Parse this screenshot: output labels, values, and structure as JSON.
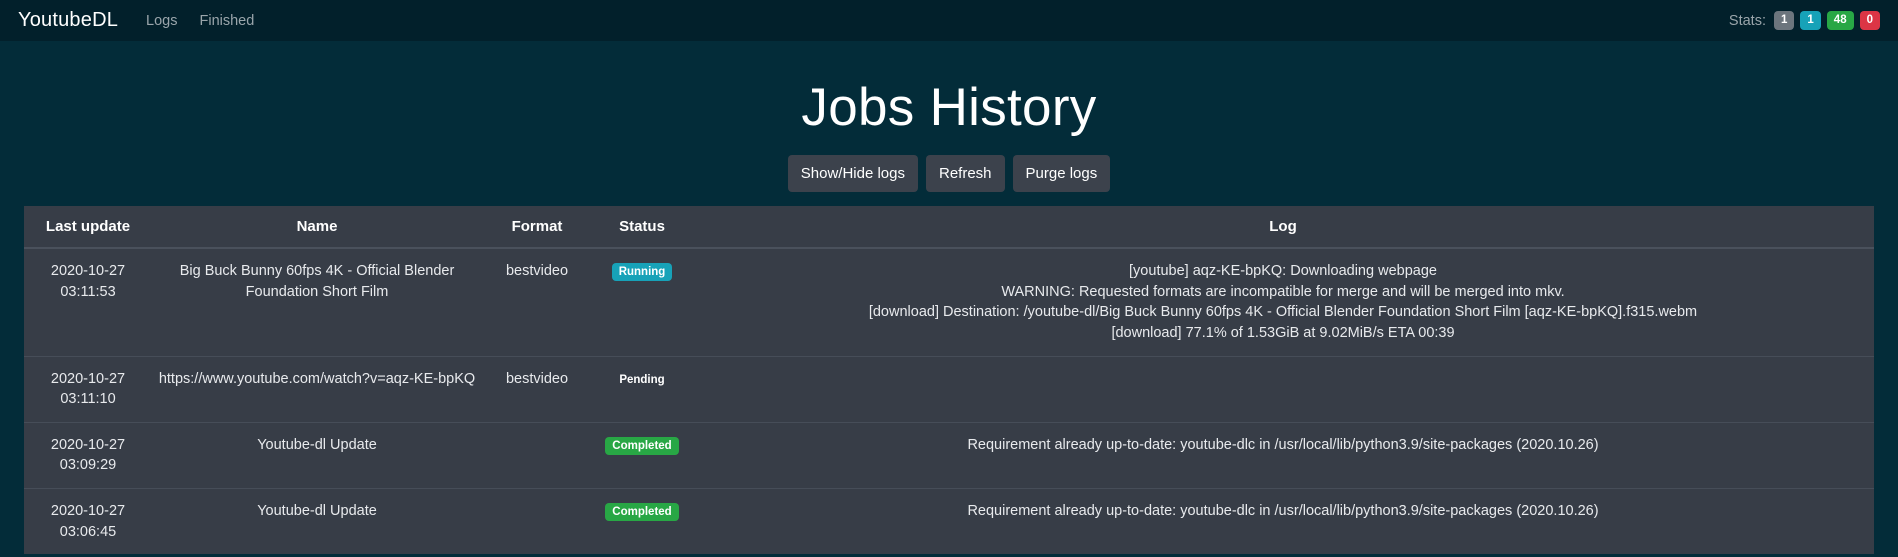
{
  "navbar": {
    "brand": "YoutubeDL",
    "links": [
      {
        "label": "Logs"
      },
      {
        "label": "Finished"
      }
    ],
    "stats_label": "Stats:",
    "stats": [
      {
        "value": "1",
        "variant": "secondary",
        "color": "#6c757d"
      },
      {
        "value": "1",
        "variant": "info",
        "color": "#17a2b8"
      },
      {
        "value": "48",
        "variant": "success",
        "color": "#28a745"
      },
      {
        "value": "0",
        "variant": "danger",
        "color": "#dc3545"
      }
    ]
  },
  "page": {
    "title": "Jobs History",
    "background_color": "#032c39",
    "navbar_color": "#02202b",
    "table_color": "#373d47"
  },
  "buttons": [
    {
      "label": "Show/Hide logs",
      "name": "show-hide-logs-button"
    },
    {
      "label": "Refresh",
      "name": "refresh-button"
    },
    {
      "label": "Purge logs",
      "name": "purge-logs-button"
    }
  ],
  "table": {
    "columns": [
      "Last update",
      "Name",
      "Format",
      "Status",
      "Log"
    ],
    "rows": [
      {
        "last_update": "2020-10-27\n03:11:53",
        "name": "Big Buck Bunny 60fps 4K - Official Blender Foundation Short Film",
        "format": "bestvideo",
        "status": "Running",
        "status_variant": "info",
        "status_color": "#17a2b8",
        "log": "[youtube] aqz-KE-bpKQ: Downloading webpage\nWARNING: Requested formats are incompatible for merge and will be merged into mkv.\n[download] Destination: /youtube-dl/Big Buck Bunny 60fps 4K - Official Blender Foundation Short Film [aqz-KE-bpKQ].f315.webm\n[download] 77.1% of 1.53GiB at 9.02MiB/s ETA 00:39"
      },
      {
        "last_update": "2020-10-27\n03:11:10",
        "name": "https://www.youtube.com/watch?v=aqz-KE-bpKQ",
        "format": "bestvideo",
        "status": "Pending",
        "status_variant": "none",
        "status_color": "transparent",
        "log": ""
      },
      {
        "last_update": "2020-10-27\n03:09:29",
        "name": "Youtube-dl Update",
        "format": "",
        "status": "Completed",
        "status_variant": "success",
        "status_color": "#28a745",
        "log": "Requirement already up-to-date: youtube-dlc in /usr/local/lib/python3.9/site-packages (2020.10.26)"
      },
      {
        "last_update": "2020-10-27\n03:06:45",
        "name": "Youtube-dl Update",
        "format": "",
        "status": "Completed",
        "status_variant": "success",
        "status_color": "#28a745",
        "log": "Requirement already up-to-date: youtube-dlc in /usr/local/lib/python3.9/site-packages (2020.10.26)"
      }
    ]
  }
}
